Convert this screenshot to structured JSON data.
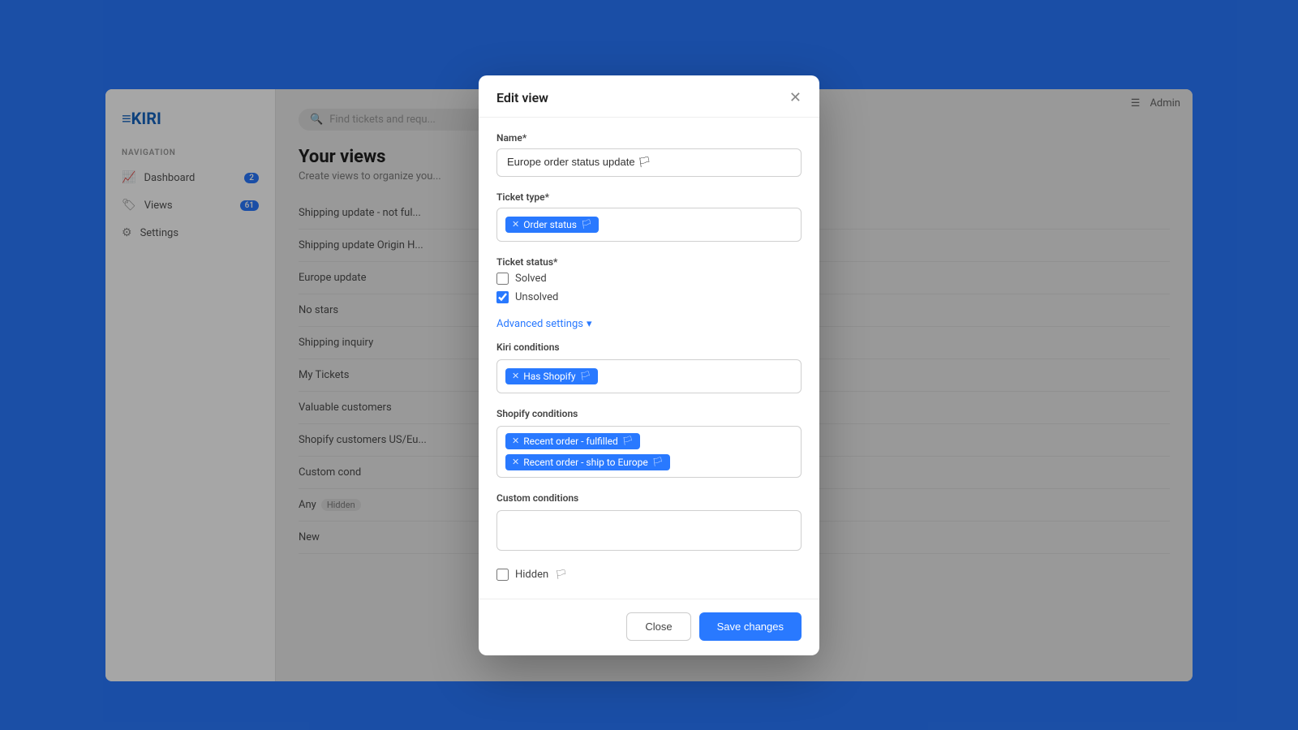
{
  "app": {
    "logo": "≡KIRI",
    "admin_label": "Admin"
  },
  "sidebar": {
    "section_label": "NAVIGATION",
    "items": [
      {
        "id": "dashboard",
        "label": "Dashboard",
        "badge": "2",
        "icon": "📈"
      },
      {
        "id": "views",
        "label": "Views",
        "badge": "61",
        "icon": "🏷"
      },
      {
        "id": "settings",
        "label": "Settings",
        "badge": "",
        "icon": "⚙"
      }
    ]
  },
  "main": {
    "search_placeholder": "Find tickets and requ...",
    "page_title": "Your views",
    "page_subtitle": "Create views to organize you...",
    "view_items": [
      {
        "label": "Shipping update - not ful..."
      },
      {
        "label": "Shipping update Origin H..."
      },
      {
        "label": "Europe update"
      },
      {
        "label": "No stars"
      },
      {
        "label": "Shipping inquiry"
      },
      {
        "label": "My Tickets"
      },
      {
        "label": "Valuable customers"
      },
      {
        "label": "Shopify customers US/Eu..."
      },
      {
        "label": "Custom cond"
      },
      {
        "label": "Any",
        "badge": "Hidden"
      },
      {
        "label": "New"
      }
    ]
  },
  "modal": {
    "title": "Edit view",
    "name_label": "Name*",
    "name_value": "Europe order status update 🏳",
    "ticket_type_label": "Ticket type*",
    "ticket_type_tags": [
      {
        "label": "Order status",
        "has_icon": true
      }
    ],
    "ticket_status_label": "Ticket status*",
    "ticket_status_options": [
      {
        "label": "Solved",
        "checked": false
      },
      {
        "label": "Unsolved",
        "checked": true
      }
    ],
    "advanced_settings_label": "Advanced settings",
    "kiri_conditions_label": "Kiri conditions",
    "kiri_condition_tags": [
      {
        "label": "Has Shopify",
        "has_icon": true
      }
    ],
    "shopify_conditions_label": "Shopify conditions",
    "shopify_condition_tags": [
      {
        "label": "Recent order - fulfilled",
        "has_icon": true
      },
      {
        "label": "Recent order - ship to Europe",
        "has_icon": true
      }
    ],
    "custom_conditions_label": "Custom conditions",
    "custom_conditions_value": "",
    "hidden_label": "Hidden",
    "hidden_checked": false,
    "close_button": "Close",
    "save_button": "Save changes"
  }
}
